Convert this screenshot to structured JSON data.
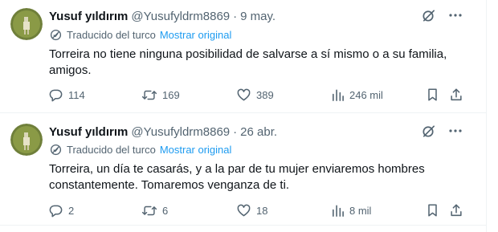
{
  "tweets": [
    {
      "author_name": "Yusuf yıldırım",
      "handle": "@Yusufyldrm8869",
      "separator": "·",
      "date": "9 may.",
      "translated_from": "Traducido del turco",
      "show_original": "Mostrar original",
      "text": "Torreira no tiene ninguna posibilidad de salvarse a sí mismo o a su familia, amigos.",
      "replies": "114",
      "retweets": "169",
      "likes": "389",
      "views": "246 mil"
    },
    {
      "author_name": "Yusuf yıldırım",
      "handle": "@Yusufyldrm8869",
      "separator": "·",
      "date": "26 abr.",
      "translated_from": "Traducido del turco",
      "show_original": "Mostrar original",
      "text": "Torreira, un día te casarás, y a la par de tu mujer enviaremos hombres constantemente. Tomaremos venganza de ti.",
      "replies": "2",
      "retweets": "6",
      "likes": "18",
      "views": "8 mil"
    }
  ],
  "icons": {
    "translate": "globe-translate-icon",
    "grok": "grok-slash-icon",
    "more": "more-options-icon",
    "reply": "reply-icon",
    "retweet": "retweet-icon",
    "like": "heart-icon",
    "views": "views-chart-icon",
    "bookmark": "bookmark-icon",
    "share": "share-icon"
  },
  "colors": {
    "text": "#0f1419",
    "muted": "#536471",
    "link": "#1d9bf0",
    "divider": "#eff3f4"
  }
}
